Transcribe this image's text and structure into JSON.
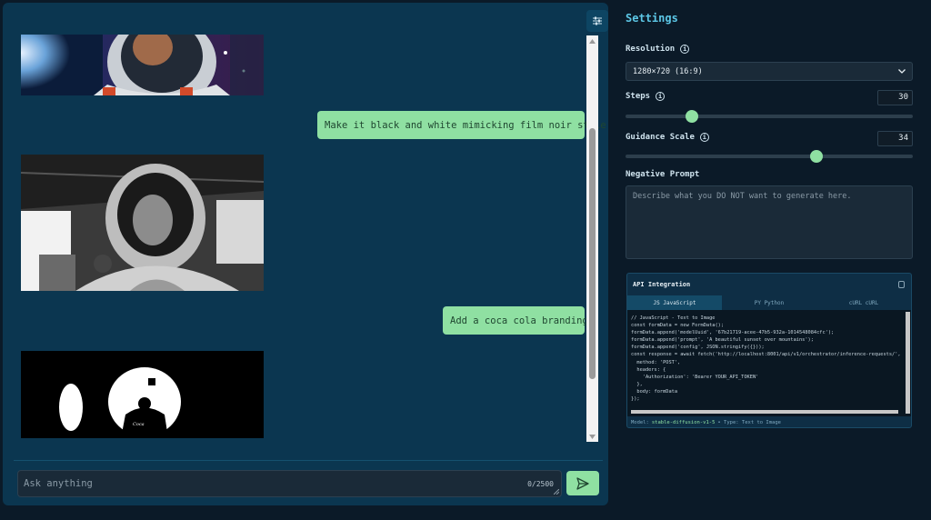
{
  "chat": {
    "messages": [
      {
        "role": "assistant",
        "type": "image",
        "description": "astronaut-color-image"
      },
      {
        "role": "user",
        "text": "Make it black and white mimicking film noir style"
      },
      {
        "role": "assistant",
        "type": "image",
        "description": "astronaut-bw-image"
      },
      {
        "role": "user",
        "text": "Add a coca cola branding"
      },
      {
        "role": "assistant",
        "type": "image",
        "description": "coca-cola-bw-image"
      }
    ],
    "input": {
      "placeholder": "Ask anything",
      "char_count": "0/2500"
    }
  },
  "settings": {
    "title": "Settings",
    "resolution": {
      "label": "Resolution",
      "value": "1280×720 (16:9)"
    },
    "steps": {
      "label": "Steps",
      "value": "30",
      "fraction": 0.23
    },
    "guidance": {
      "label": "Guidance Scale",
      "value": "34",
      "fraction": 0.665
    },
    "negative_prompt": {
      "label": "Negative Prompt",
      "placeholder": "Describe what you DO NOT want to generate here."
    }
  },
  "api": {
    "title": "API Integration",
    "tabs": [
      "JS JavaScript",
      "PY Python",
      "cURL cURL"
    ],
    "active_tab": 0,
    "code": [
      "// JavaScript - Text to Image",
      "const formData = new FormData();",
      "formData.append('modelUuid', '67b21719-acee-47b5-932a-1014548084cfc');",
      "formData.append('prompt', 'A beautiful sunset over mountains');",
      "formData.append('config', JSON.stringify({}));",
      "",
      "const response = await fetch('http://localhost:8001/api/v1/orchestrator/inference-requests/',",
      "  method: 'POST',",
      "  headers: {",
      "    'Authorization': 'Bearer YOUR_API_TOKEN'",
      "  },",
      "  body: formData",
      "});"
    ],
    "footer": {
      "model_label": "Model:",
      "model_name": "stable-diffusion-v1-5",
      "type_text": "• Type: Text to Image"
    }
  },
  "colors": {
    "accent": "#8fe0a2",
    "title": "#5cc7e6",
    "panel": "#0b3650",
    "background": "#0b1a28"
  },
  "icons": {
    "settings_toggle": "sliders-icon",
    "send": "send-icon",
    "info": "info-icon",
    "copy": "copy-icon"
  }
}
